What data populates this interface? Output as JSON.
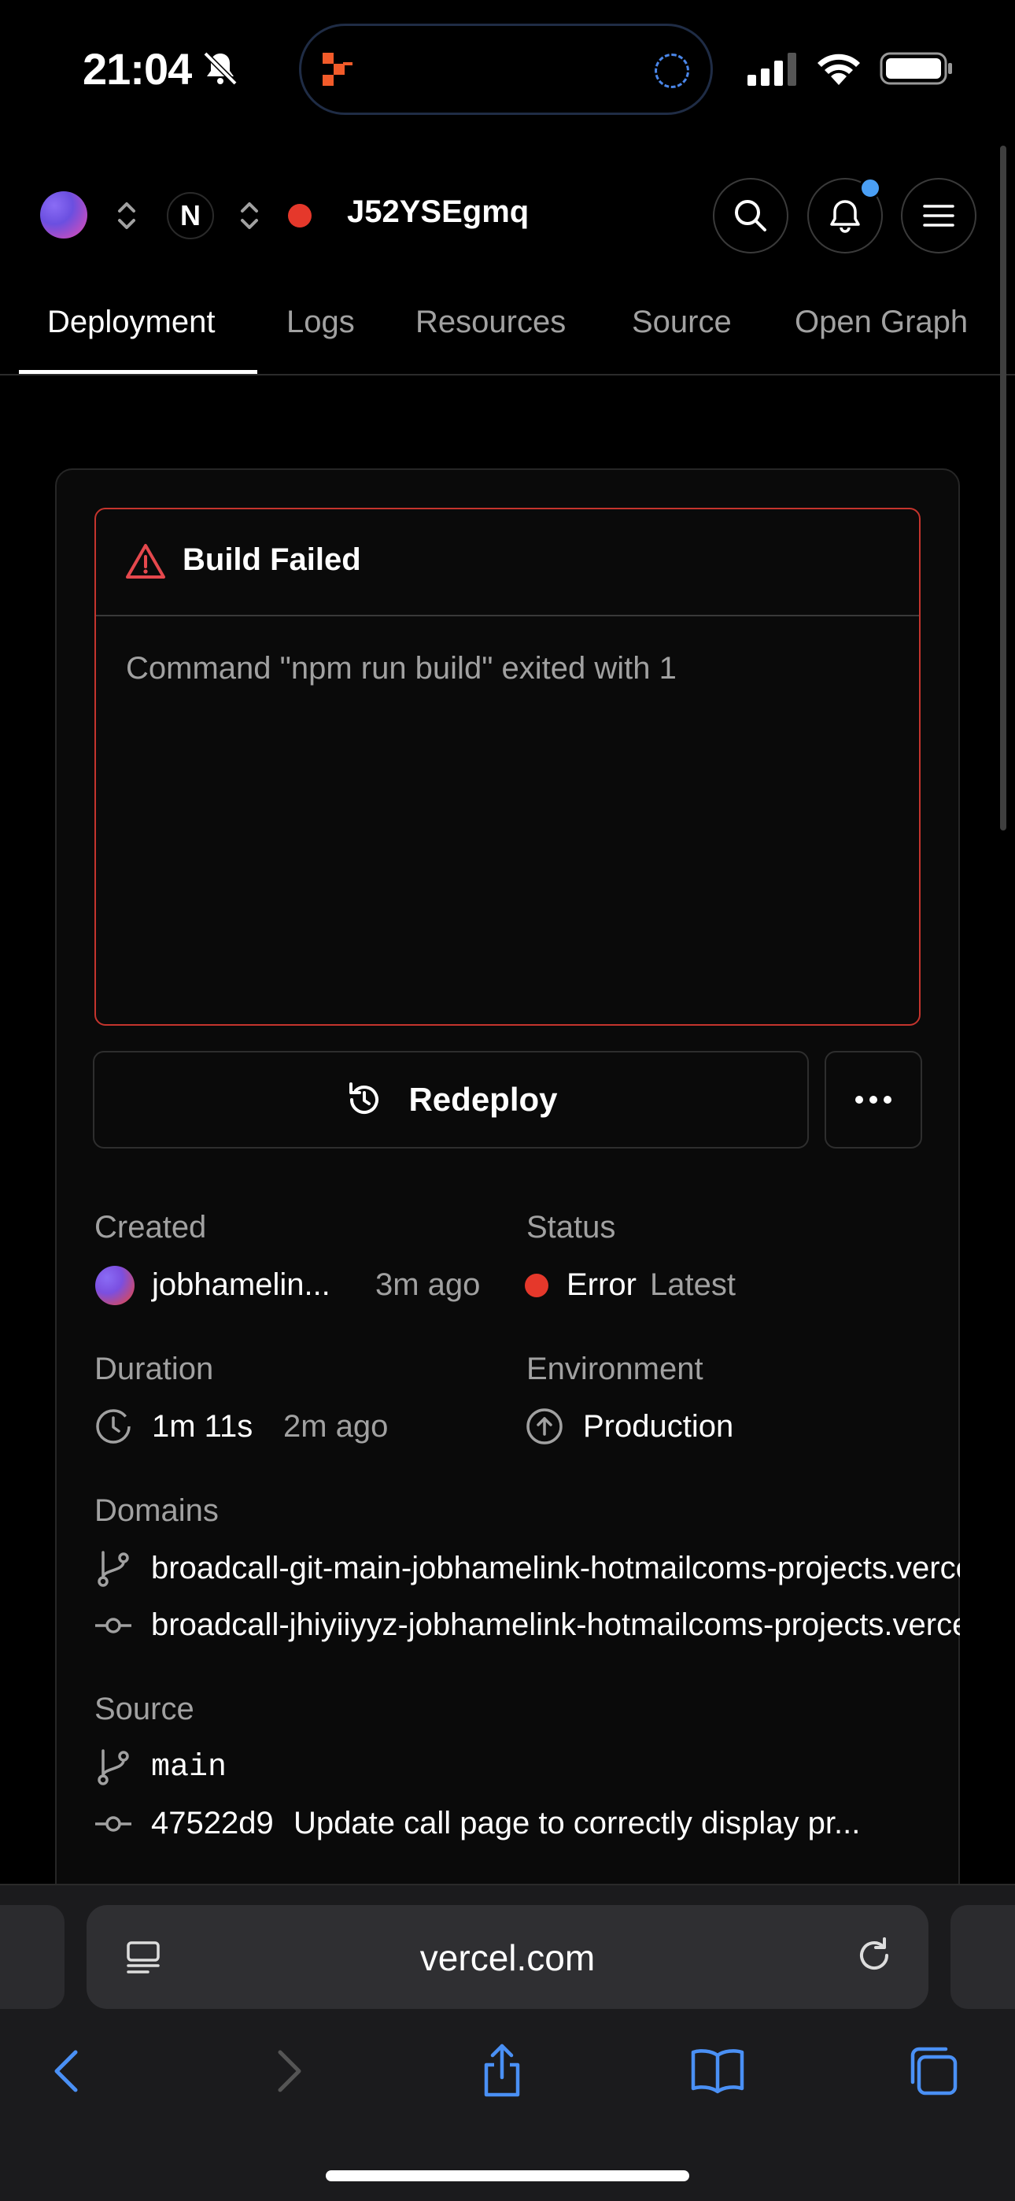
{
  "status_bar": {
    "time": "21:04"
  },
  "header": {
    "project_id": "J52YSEgmq",
    "team_initial": "N"
  },
  "tabs": [
    {
      "label": "Deployment",
      "active": true
    },
    {
      "label": "Logs"
    },
    {
      "label": "Resources"
    },
    {
      "label": "Source"
    },
    {
      "label": "Open Graph"
    }
  ],
  "error": {
    "title": "Build Failed",
    "message": "Command \"npm run build\" exited with 1"
  },
  "actions": {
    "redeploy_label": "Redeploy"
  },
  "details": {
    "created_label": "Created",
    "created_user": "jobhamelin...",
    "created_ago": "3m ago",
    "status_label": "Status",
    "status_value": "Error",
    "status_tag": "Latest",
    "duration_label": "Duration",
    "duration_value": "1m 11s",
    "duration_ago": "2m ago",
    "environment_label": "Environment",
    "environment_value": "Production",
    "domains_label": "Domains",
    "domains": [
      "broadcall-git-main-jobhamelink-hotmailcoms-projects.vercel.app",
      "broadcall-jhiyiiyyz-jobhamelink-hotmailcoms-projects.vercel.app"
    ],
    "source_label": "Source",
    "source_branch": "main",
    "commit_hash": "47522d9",
    "commit_message": "Update call page to correctly display pr..."
  },
  "browser": {
    "url": "vercel.com"
  },
  "colors": {
    "error": "#e5382b",
    "accent": "#4a9ff5",
    "background": "#000000"
  }
}
